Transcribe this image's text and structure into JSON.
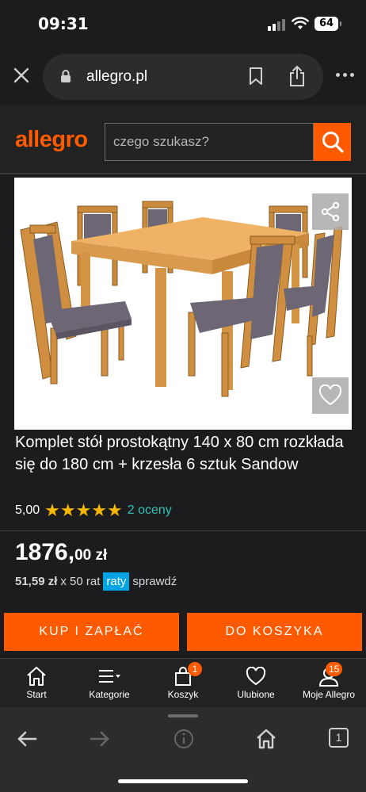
{
  "status_bar": {
    "time": "09:31",
    "battery": "64"
  },
  "browser": {
    "url": "allegro.pl"
  },
  "header": {
    "logo": "allegro",
    "search_placeholder": "czego szukasz?"
  },
  "product": {
    "title": "Komplet stół prostokątny 140 x 80 cm rozkłada się do 180 cm + krzesła 6 sztuk Sandow",
    "rating_value": "5,00",
    "stars": "★★★★★",
    "reviews": "2 oceny",
    "price_main": "1876,",
    "price_cents": "00 zł",
    "installment_amount": "51,59 zł",
    "installment_count": "x 50 rat",
    "raty_label": "raty",
    "check_label": "sprawdź"
  },
  "actions": {
    "buy_now": "KUP I ZAPŁAĆ",
    "add_to_cart": "DO KOSZYKA"
  },
  "bottom_nav": {
    "items": [
      {
        "label": "Start"
      },
      {
        "label": "Kategorie"
      },
      {
        "label": "Koszyk",
        "badge": "1"
      },
      {
        "label": "Ulubione"
      },
      {
        "label": "Moje Allegro",
        "badge": "15"
      }
    ]
  },
  "toolbar": {
    "tabs_count": "1"
  },
  "colors": {
    "brand": "#ff5a00",
    "rating_stars": "#f5b700",
    "reviews_link": "#33c0b5",
    "raty_badge": "#00a4e4"
  }
}
